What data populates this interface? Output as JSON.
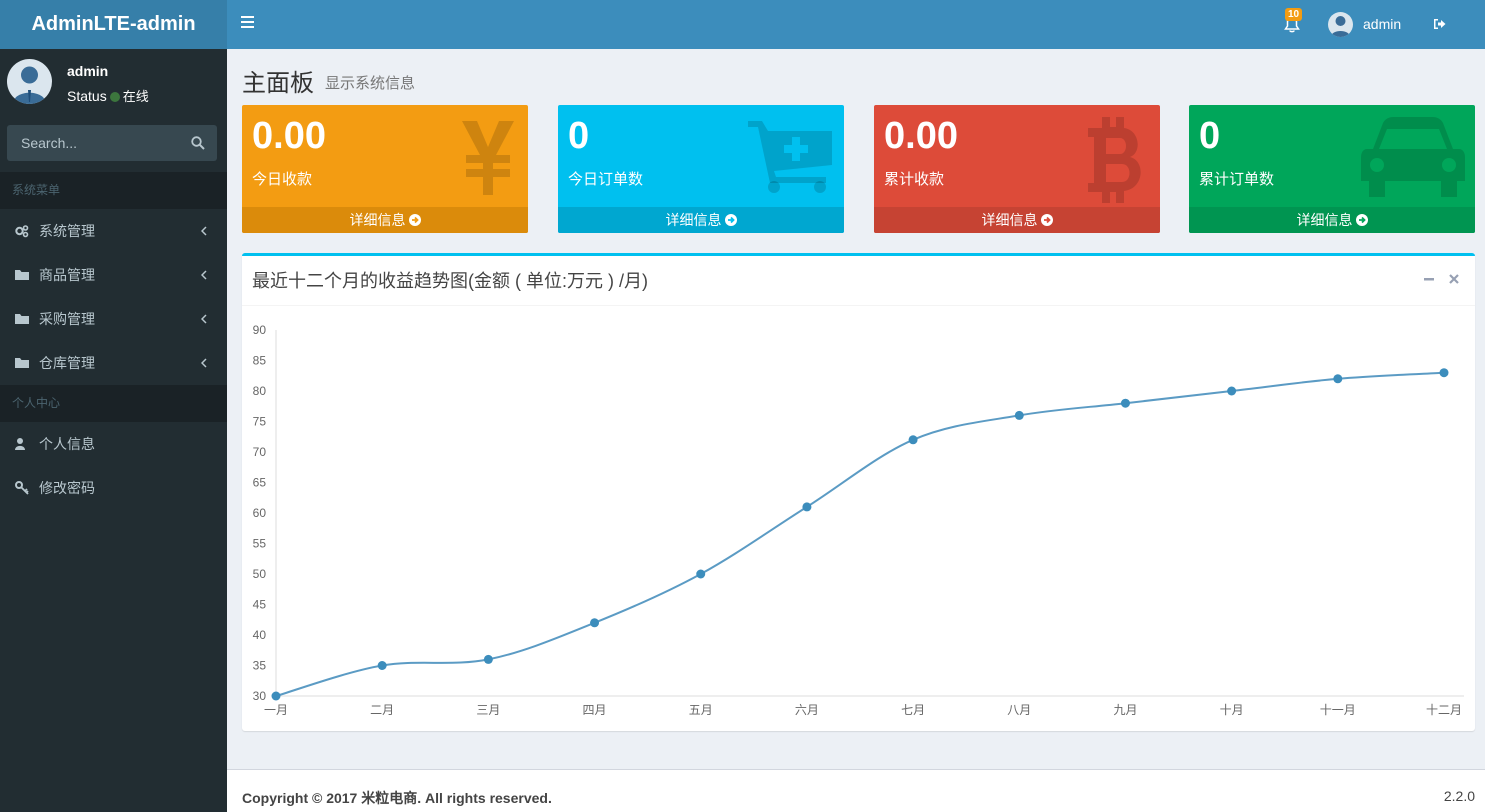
{
  "brand": "AdminLTE-admin",
  "topbar": {
    "notifications_count": "10",
    "user_name": "admin"
  },
  "sidebar": {
    "user_name": "admin",
    "status_label": "Status",
    "status_value": "在线",
    "search_placeholder": "Search...",
    "section1": "系统菜单",
    "items1": [
      "系统管理",
      "商品管理",
      "采购管理",
      "仓库管理"
    ],
    "section2": "个人中心",
    "items2": [
      "个人信息",
      "修改密码"
    ]
  },
  "page": {
    "title": "主面板",
    "subtitle": "显示系统信息"
  },
  "stats": [
    {
      "value": "0.00",
      "label": "今日收款",
      "link": "详细信息",
      "color": "#f39c12",
      "footer_color": "#db8b0b",
      "icon": "yen-icon"
    },
    {
      "value": "0",
      "label": "今日订单数",
      "link": "详细信息",
      "color": "#00c0ef",
      "footer_color": "#00a7d0",
      "icon": "cart-icon"
    },
    {
      "value": "0.00",
      "label": "累计收款",
      "link": "详细信息",
      "color": "#dd4b39",
      "footer_color": "#c64333",
      "icon": "bitcoin-icon"
    },
    {
      "value": "0",
      "label": "累计订单数",
      "link": "详细信息",
      "color": "#00a65a",
      "footer_color": "#009551",
      "icon": "car-icon"
    }
  ],
  "chart_box": {
    "title": "最近十二个月的收益趋势图(金额 ( 单位:万元 ) /月)"
  },
  "chart_data": {
    "type": "line",
    "categories": [
      "一月",
      "二月",
      "三月",
      "四月",
      "五月",
      "六月",
      "七月",
      "八月",
      "九月",
      "十月",
      "十一月",
      "十二月"
    ],
    "values": [
      30,
      35,
      36,
      42,
      50,
      61,
      72,
      76,
      78,
      80,
      82,
      83
    ],
    "ylim": [
      30,
      90
    ],
    "yticks": [
      30,
      35,
      40,
      45,
      50,
      55,
      60,
      65,
      70,
      75,
      80,
      85,
      90
    ],
    "line_color": "#5b9bc4",
    "point_color": "#3c8dbc"
  },
  "footer": {
    "copyright": "Copyright © 2017 米粒电商. All rights reserved.",
    "version": "2.2.0"
  }
}
